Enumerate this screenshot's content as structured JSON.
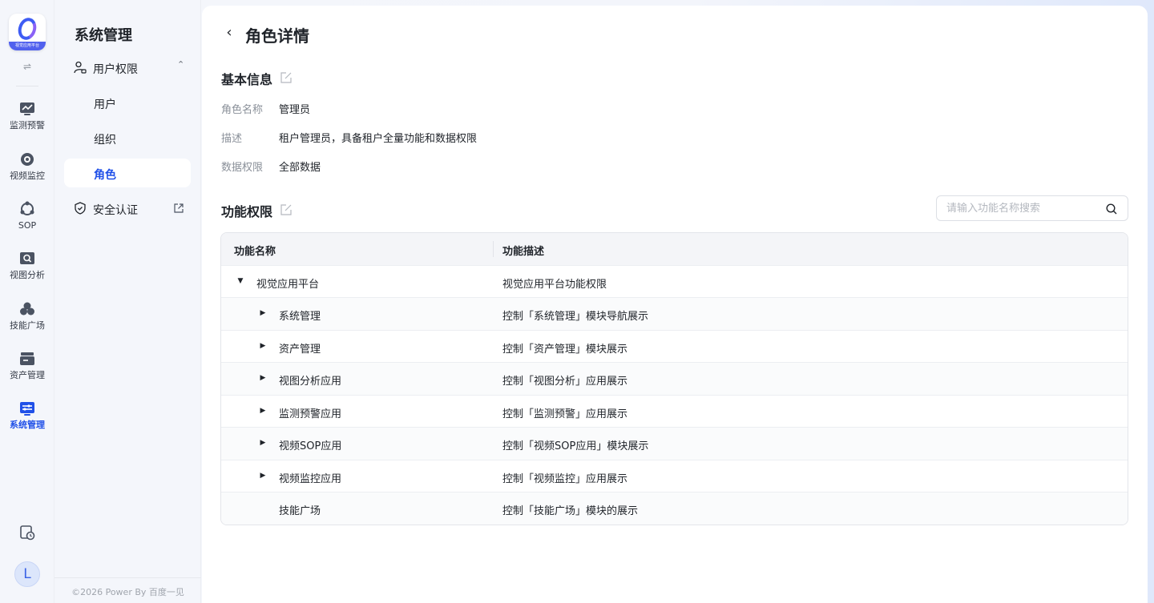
{
  "app": {
    "logo_caption": "视觉应用平台"
  },
  "rail": {
    "toggle_glyph": "⇌",
    "items": [
      {
        "label": "监测预警",
        "icon": "monitor-chart-icon"
      },
      {
        "label": "视频监控",
        "icon": "camera-icon"
      },
      {
        "label": "SOP",
        "icon": "sop-icon"
      },
      {
        "label": "视图分析",
        "icon": "image-search-icon"
      },
      {
        "label": "技能广场",
        "icon": "skills-icon"
      },
      {
        "label": "资产管理",
        "icon": "asset-icon"
      },
      {
        "label": "系统管理",
        "icon": "system-icon"
      }
    ],
    "active_index": 6,
    "user_initial": "L"
  },
  "submenu": {
    "title": "系统管理",
    "group_label": "用户权限",
    "group_chevron": "⌃",
    "sub_items": [
      "用户",
      "组织",
      "角色"
    ],
    "active_sub": "角色",
    "external_item": "安全认证",
    "copyright": "©2026 Power By 百度一见"
  },
  "page": {
    "back_glyph": "‹",
    "title": "角色详情",
    "basic_section": "基本信息",
    "basic_info": [
      {
        "key": "角色名称",
        "value": "管理员"
      },
      {
        "key": "描述",
        "value": "租户管理员，具备租户全量功能和数据权限"
      },
      {
        "key": "数据权限",
        "value": "全部数据"
      }
    ],
    "perm_section": "功能权限",
    "search_placeholder": "请输入功能名称搜索"
  },
  "table": {
    "headers": {
      "name": "功能名称",
      "desc": "功能描述"
    },
    "rows": [
      {
        "name": "视觉应用平台",
        "desc": "视觉应用平台功能权限",
        "level": 0,
        "caret": "▼"
      },
      {
        "name": "系统管理",
        "desc": "控制「系统管理」模块导航展示",
        "level": 1,
        "caret": "▶"
      },
      {
        "name": "资产管理",
        "desc": "控制「资产管理」模块展示",
        "level": 1,
        "caret": "▶"
      },
      {
        "name": "视图分析应用",
        "desc": "控制「视图分析」应用展示",
        "level": 1,
        "caret": "▶"
      },
      {
        "name": "监测预警应用",
        "desc": "控制「监测预警」应用展示",
        "level": 1,
        "caret": "▶"
      },
      {
        "name": "视频SOP应用",
        "desc": "控制「视频SOP应用」模块展示",
        "level": 1,
        "caret": "▶"
      },
      {
        "name": "视频监控应用",
        "desc": "控制「视频监控」应用展示",
        "level": 1,
        "caret": "▶"
      },
      {
        "name": "技能广场",
        "desc": "控制「技能广场」模块的展示",
        "level": 1,
        "caret": ""
      }
    ]
  },
  "colors": {
    "accent": "#2050e8",
    "rail_icon": "#4b5362"
  }
}
